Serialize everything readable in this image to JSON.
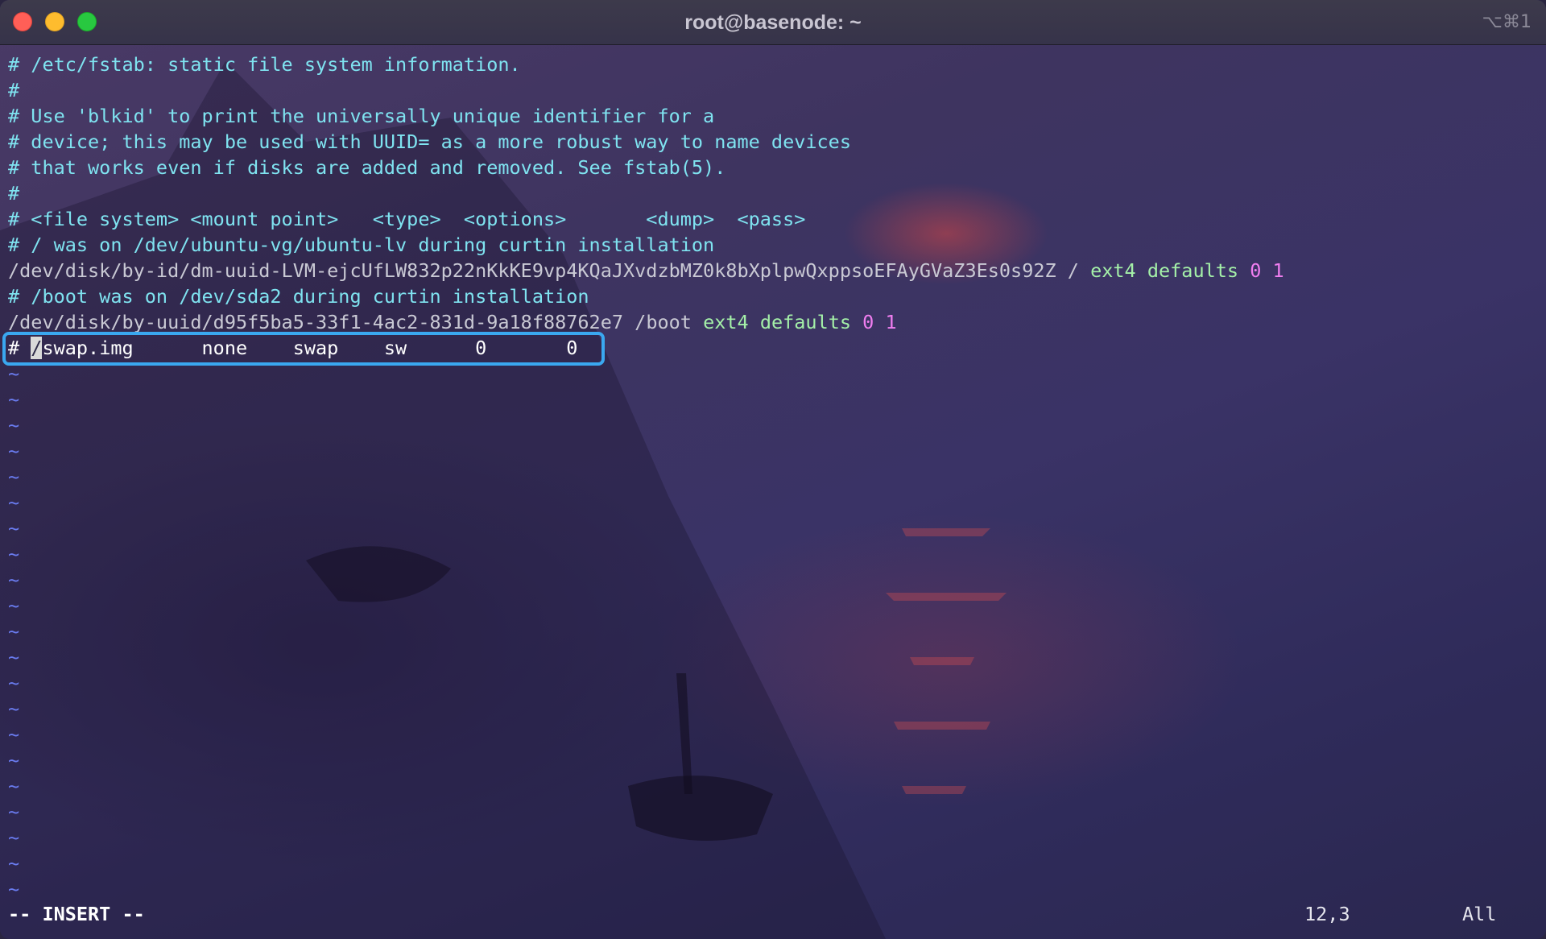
{
  "window": {
    "title": "root@basenode: ~",
    "shortcut": "⌥⌘1"
  },
  "editor": {
    "lines": [
      {
        "kind": "comment",
        "text": "# /etc/fstab: static file system information."
      },
      {
        "kind": "comment",
        "text": "#"
      },
      {
        "kind": "comment",
        "text": "# Use 'blkid' to print the universally unique identifier for a"
      },
      {
        "kind": "comment",
        "text": "# device; this may be used with UUID= as a more robust way to name devices"
      },
      {
        "kind": "comment",
        "text": "# that works even if disks are added and removed. See fstab(5)."
      },
      {
        "kind": "comment",
        "text": "#"
      },
      {
        "kind": "comment",
        "text": "# <file system> <mount point>   <type>  <options>       <dump>  <pass>"
      },
      {
        "kind": "comment",
        "text": "# / was on /dev/ubuntu-vg/ubuntu-lv during curtin installation"
      },
      {
        "kind": "entry",
        "device": "/dev/disk/by-id/dm-uuid-LVM-ejcUfLW832p22nKkKE9vp4KQaJXvdzbMZ0k8bXplpwQxppsoEFAyGVaZ3Es0s92Z",
        "mount": "/",
        "fstype": "ext4",
        "options": "defaults",
        "dump": "0",
        "pass": "1"
      },
      {
        "kind": "comment",
        "text": "# /boot was on /dev/sda2 during curtin installation"
      },
      {
        "kind": "entry",
        "device": "/dev/disk/by-uuid/d95f5ba5-33f1-4ac2-831d-9a18f88762e7",
        "mount": "/boot",
        "fstype": "ext4",
        "options": "defaults",
        "dump": "0",
        "pass": "1"
      },
      {
        "kind": "cursorline",
        "before": "# ",
        "cursor_char": "/",
        "after": "swap.img      none    swap    sw      0       0"
      }
    ],
    "tilde": "~",
    "tilde_count": 21
  },
  "status": {
    "mode": "-- INSERT --",
    "position": "12,3",
    "scroll": "All"
  },
  "colors": {
    "comment": "#7fe3f0",
    "type": "#a4f0a8",
    "number": "#f07ef0",
    "tilde": "#6a7cf0",
    "highlight": "#3aa8f0"
  }
}
